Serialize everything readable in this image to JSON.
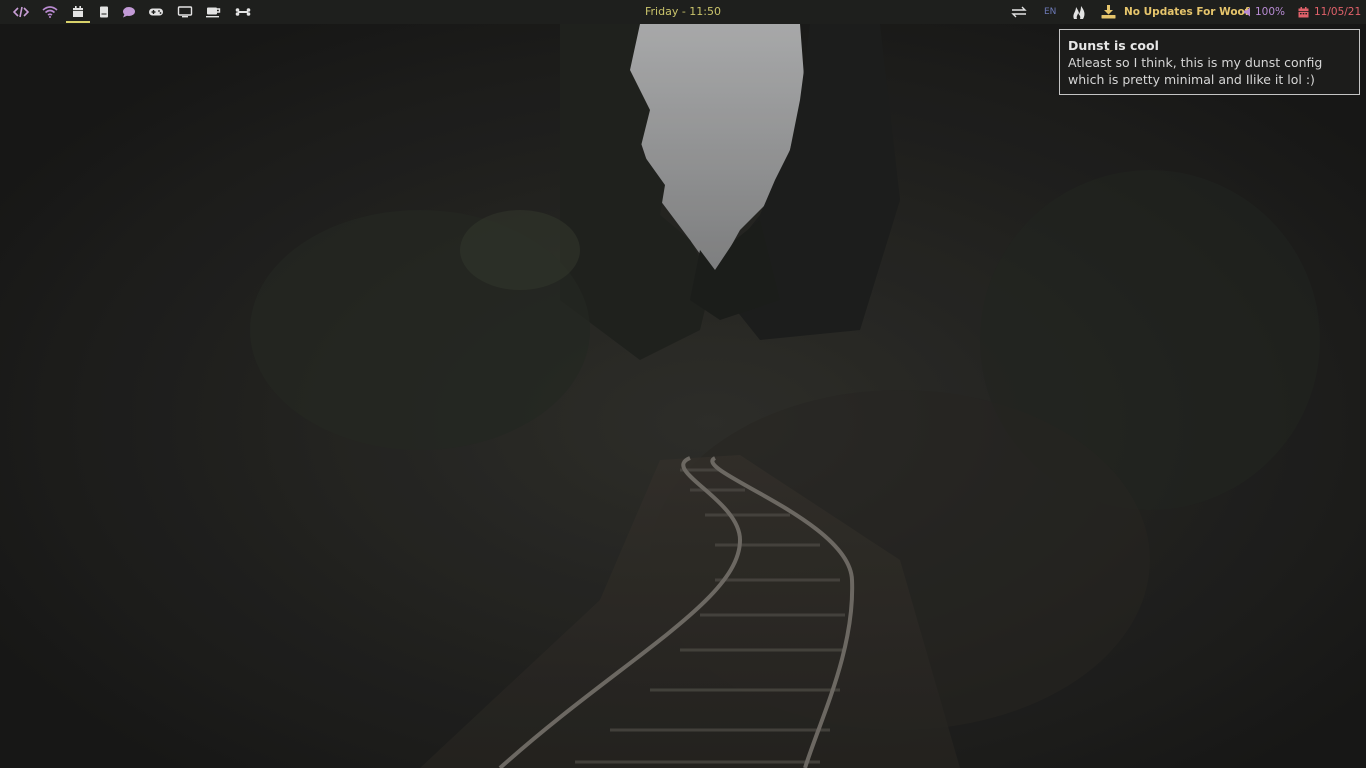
{
  "workspaces": [
    {
      "icon": "code-icon",
      "color": "#c99ed6"
    },
    {
      "icon": "wifi-icon",
      "color": "#b98ad0"
    },
    {
      "icon": "calendar-icon",
      "color": "#e3e3e3",
      "active": true
    },
    {
      "icon": "book-icon",
      "color": "#e3e3e3"
    },
    {
      "icon": "chat-bubble-icon",
      "color": "#c29ad6"
    },
    {
      "icon": "gamepad-icon",
      "color": "#e3e3e3"
    },
    {
      "icon": "monitor-icon",
      "color": "#e3e3e3"
    },
    {
      "icon": "coffee-cup-icon",
      "color": "#e3e3e3"
    },
    {
      "icon": "bone-icon",
      "color": "#e3e3e3"
    }
  ],
  "bar": {
    "clock": "Friday - 11:50",
    "language": "EN",
    "updates": "No Updates For Woof",
    "volume": "100%",
    "date": "11/05/21"
  },
  "notification": {
    "summary": "Dunst is cool",
    "body_line1": "Atleast so I think, this is my dunst config",
    "body_line2": "which is pretty minimal and Ilike it lol :)"
  },
  "colors": {
    "bar_bg": "#1e1f1d",
    "clock": "#c9c36b",
    "language": "#6c79b6",
    "updates": "#e6c56c",
    "volume": "#b88bd4",
    "date": "#e0616a",
    "active_ws_underline": "#d8d16a"
  }
}
